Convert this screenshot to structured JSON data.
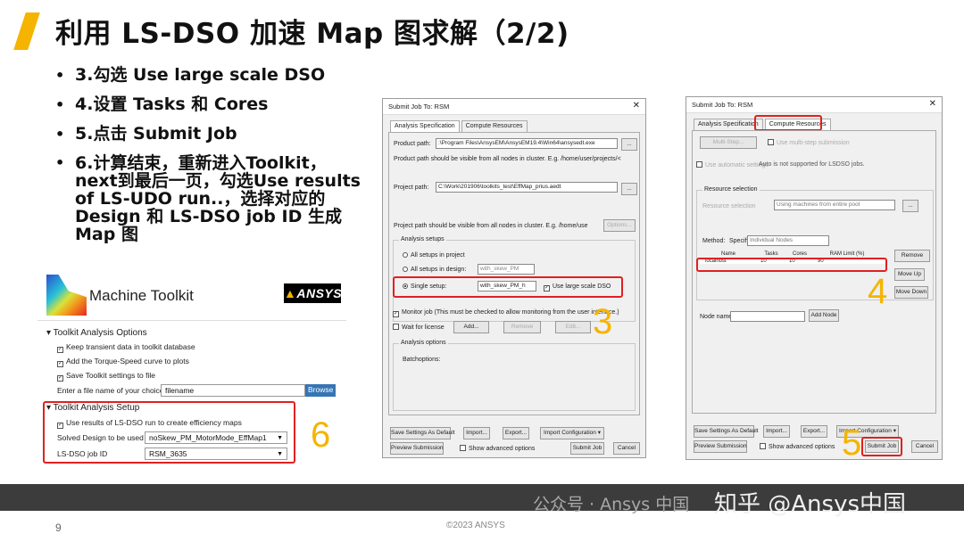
{
  "slide": {
    "title": "利用 LS-DSO 加速 Map 图求解（2/2)",
    "bullets": [
      "3.勾选 Use large scale DSO",
      "4.设置 Tasks 和 Cores",
      "5.点击 Submit Job",
      "6.计算结束，重新进入Toolkit，next到最后一页，勾选Use results of LS-UDO run..，选择对应的 Design 和 LS-DSO job ID 生成 Map 图"
    ],
    "page_number": "9",
    "copyright": "©2023  ANSYS",
    "watermark": "公众号 · Ansys 中国",
    "zhihu": "知乎 @Ansys中国",
    "accent_color": "#f5b400",
    "highlight_color": "#e02020"
  },
  "toolkit": {
    "app_title": "Machine Toolkit",
    "logo_text": "ANSYS",
    "analysis_options_header": "Toolkit Analysis Options",
    "opt_transient": "Keep transient data in toolkit database",
    "opt_torque": "Add the Torque-Speed curve to plots",
    "opt_save": "Save Toolkit settings to file",
    "file_label": "Enter a file name of your choice",
    "file_value": "filename",
    "browse": "Browse",
    "setup_header": "Toolkit Analysis Setup",
    "use_lsdso": "Use results of LS-DSO run to create efficiency maps",
    "design_label": "Solved Design to be used",
    "design_value": "noSkew_PM_MotorMode_EffMap1",
    "jobid_label": "LS-DSO job ID",
    "jobid_value": "RSM_3635",
    "step_number": "6"
  },
  "dialog1": {
    "title": "Submit Job To: RSM",
    "tab_analysis": "Analysis Specification",
    "tab_compute": "Compute Resources",
    "product_path_label": "Product path:",
    "product_path_value": ":\\Program Files\\AnsysEM\\AnsysEM19.4\\Win64\\ansysedt.exe",
    "product_hint": "Product path should be visible from all nodes in cluster. E.g. /home/user/projects/<",
    "project_path_label": "Project path:",
    "project_path_value": "C:\\Work\\201906\\toolkits_test\\EffMap_prius.aedt",
    "project_hint": "Project path should be visible from all nodes in cluster. E.g. /home/use",
    "options_btn": "Options...",
    "setups_group": "Analysis setups",
    "all_project": "All setups in project",
    "all_design": "All setups in design:",
    "design_sel": "with_skew_PM",
    "single_setup": "Single setup:",
    "single_sel": "with_skew_PM_h",
    "use_large": "Use large scale DSO",
    "monitor": "Monitor job (This must be checked to allow monitoring from the user interface.)",
    "wait_license": "Wait for license",
    "add_btn": "Add...",
    "remove_btn": "Remove",
    "edit_btn": "Edit...",
    "options_group": "Analysis options",
    "batchoptions": "Batchoptions:",
    "save_default": "Save Settings As Default",
    "import_btn": "Import...",
    "export_btn": "Export...",
    "import_config": "Import Configuration",
    "preview": "Preview Submission",
    "show_adv": "Show advanced options",
    "submit": "Submit Job",
    "cancel": "Cancel",
    "step_number": "3",
    "dots": "..."
  },
  "dialog2": {
    "title": "Submit Job To: RSM",
    "tab_analysis": "Analysis Specification",
    "tab_compute": "Compute Resources",
    "multistep_btn": "Multi-Step...",
    "use_multistep": "Use multi-step submission",
    "use_auto": "Use automatic settings",
    "auto_note": "Auto is not supported for LSDSO jobs.",
    "res_group": "Resource selection",
    "res_label": "Resource selection",
    "res_value": "Using machines from entire pool",
    "method_label": "Method:",
    "method_specify": "Specify",
    "method_value": "Individual Nodes",
    "columns": [
      "Name",
      "Tasks",
      "Cores",
      "RAM Limit (%)"
    ],
    "row": [
      "localhost",
      "10",
      "10",
      "90"
    ],
    "remove_btn": "Remove",
    "moveup_btn": "Move Up",
    "movedown_btn": "Move Down",
    "node_label": "Node name:",
    "add_node": "Add Node",
    "save_default": "Save Settings As Default",
    "import_btn": "Import...",
    "export_btn": "Export...",
    "import_config": "Import Configuration",
    "preview": "Preview Submission",
    "show_adv": "Show advanced options",
    "submit": "Submit Job",
    "cancel": "Cancel",
    "step4": "4",
    "step5": "5",
    "dots": "..."
  }
}
